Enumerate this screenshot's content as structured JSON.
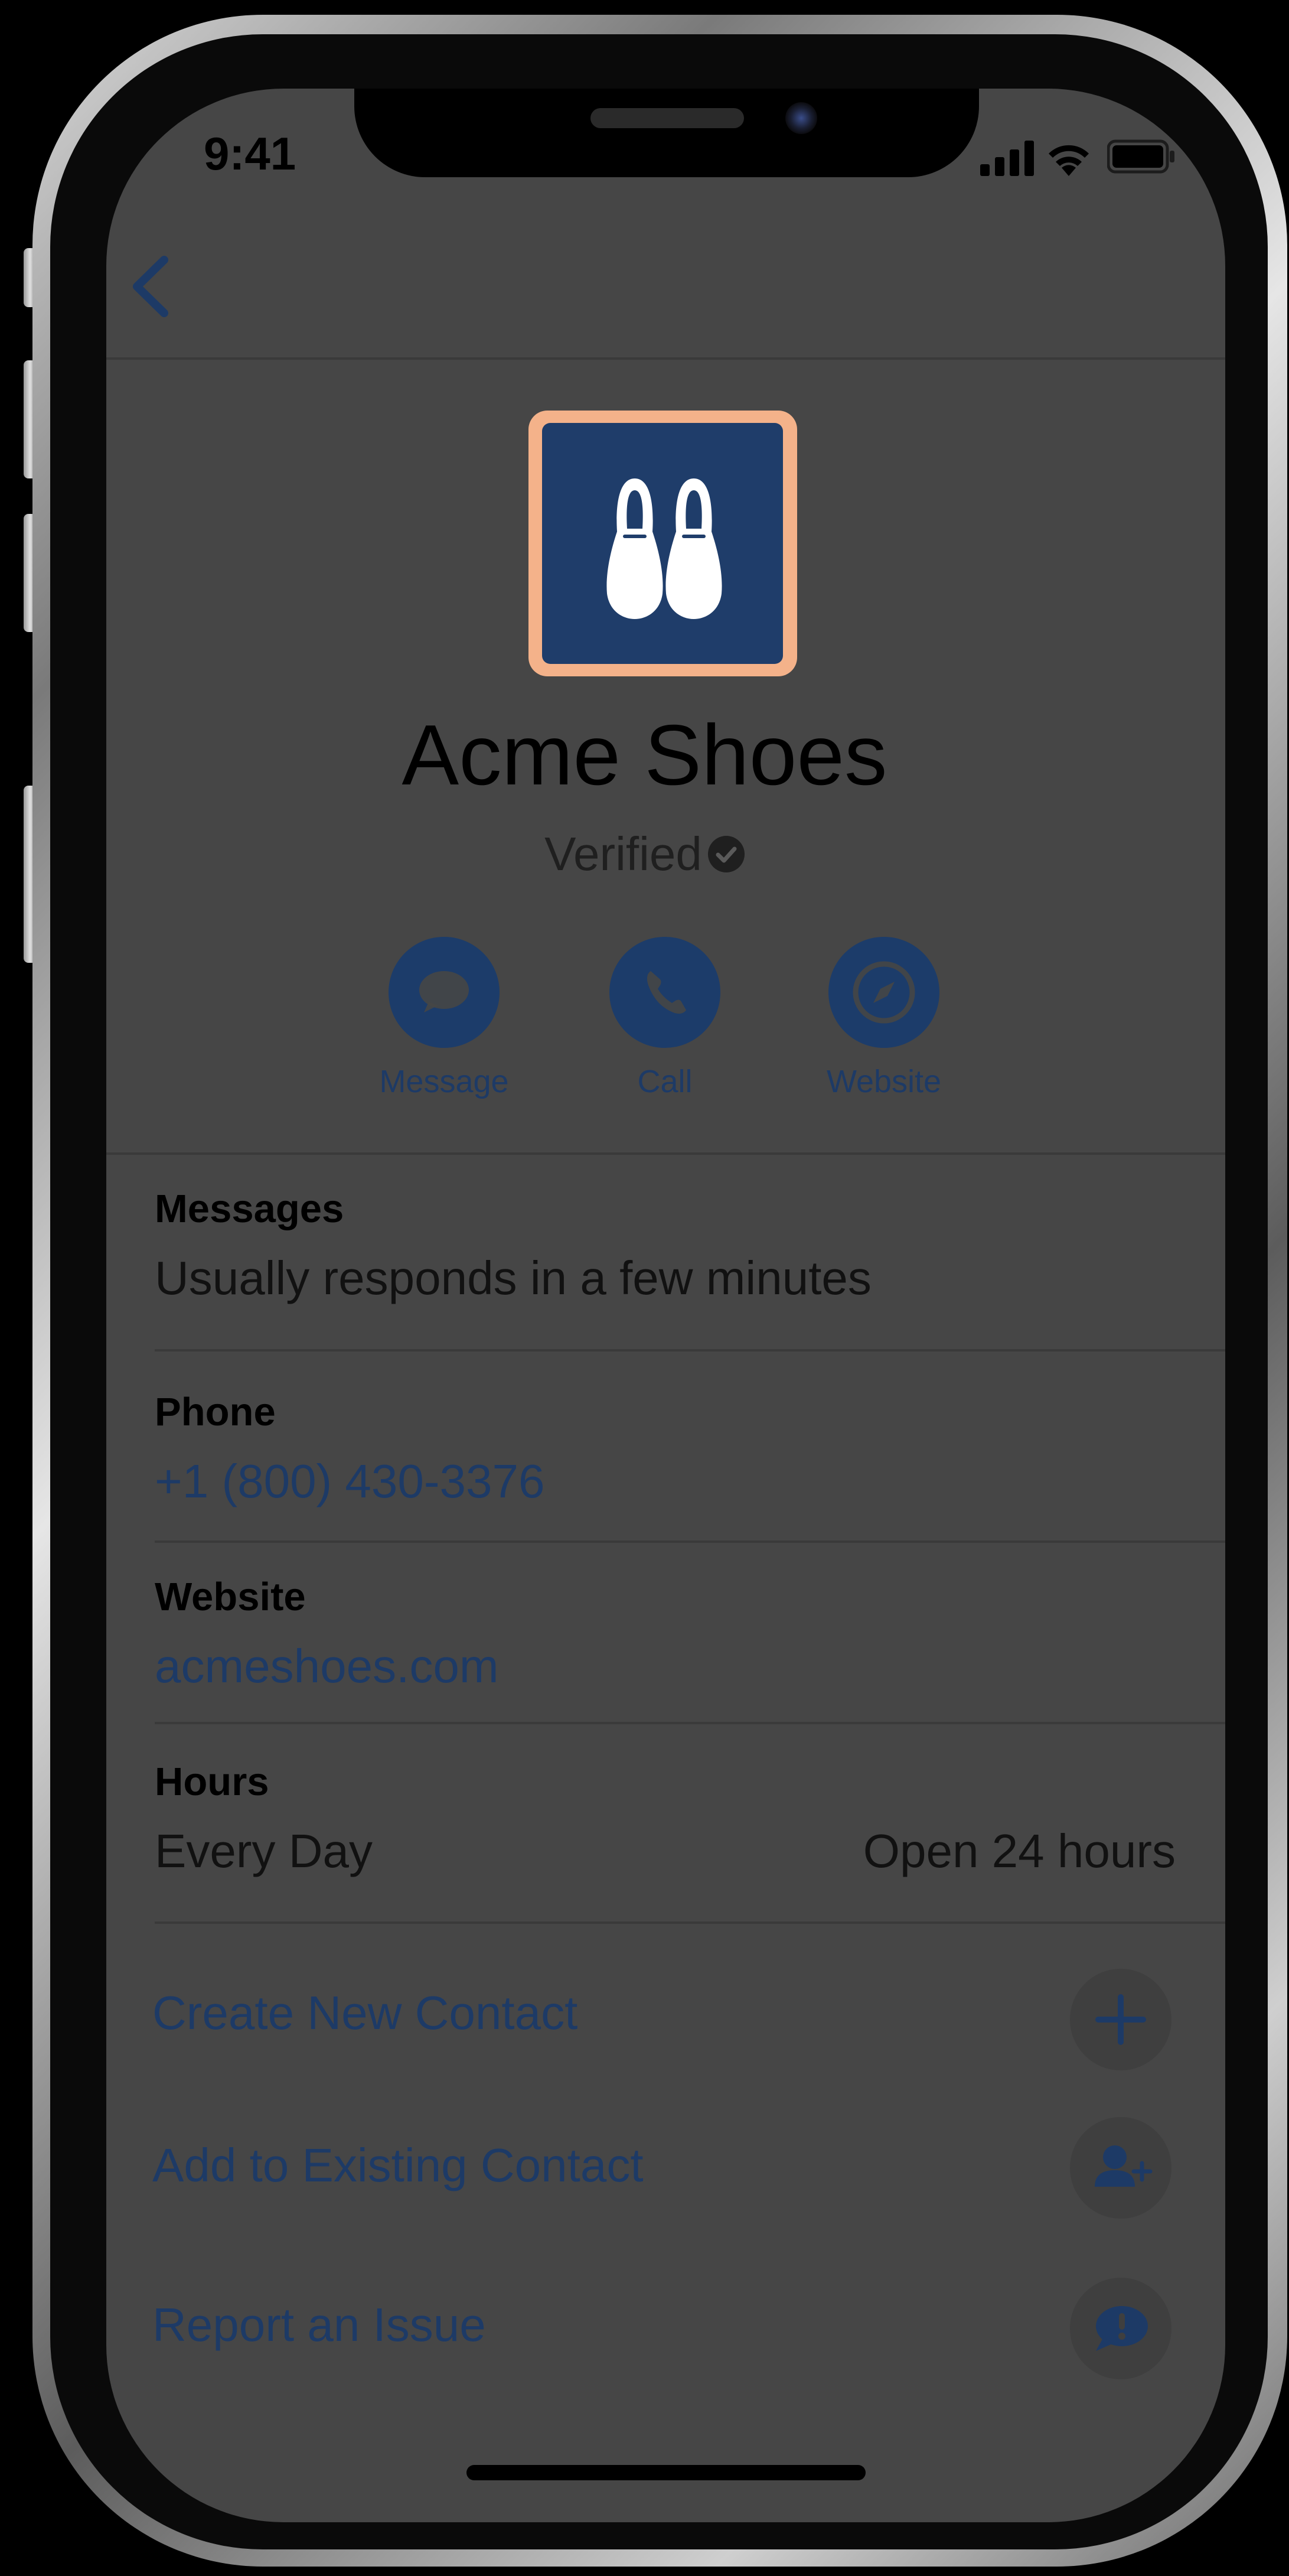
{
  "status_bar": {
    "time": "9:41"
  },
  "business": {
    "name": "Acme Shoes",
    "verified_label": "Verified"
  },
  "actions": [
    {
      "label": "Message",
      "icon": "message-bubble-icon"
    },
    {
      "label": "Call",
      "icon": "phone-icon"
    },
    {
      "label": "Website",
      "icon": "compass-icon"
    }
  ],
  "details": {
    "messages": {
      "label": "Messages",
      "value": "Usually responds in a few minutes"
    },
    "phone": {
      "label": "Phone",
      "value": "+1 (800) 430-3376"
    },
    "website": {
      "label": "Website",
      "value": "acmeshoes.com"
    },
    "hours": {
      "label": "Hours",
      "day": "Every Day",
      "time": "Open 24 hours"
    }
  },
  "links": [
    {
      "label": "Create New Contact",
      "icon": "plus-icon"
    },
    {
      "label": "Add to Existing Contact",
      "icon": "add-person-icon"
    },
    {
      "label": "Report an Issue",
      "icon": "exclamation-bubble-icon"
    }
  ],
  "colors": {
    "screen": "#464646",
    "accent": "#1d3a66",
    "logo_bg": "#1f3d6a",
    "logo_border": "#f4b28a"
  }
}
